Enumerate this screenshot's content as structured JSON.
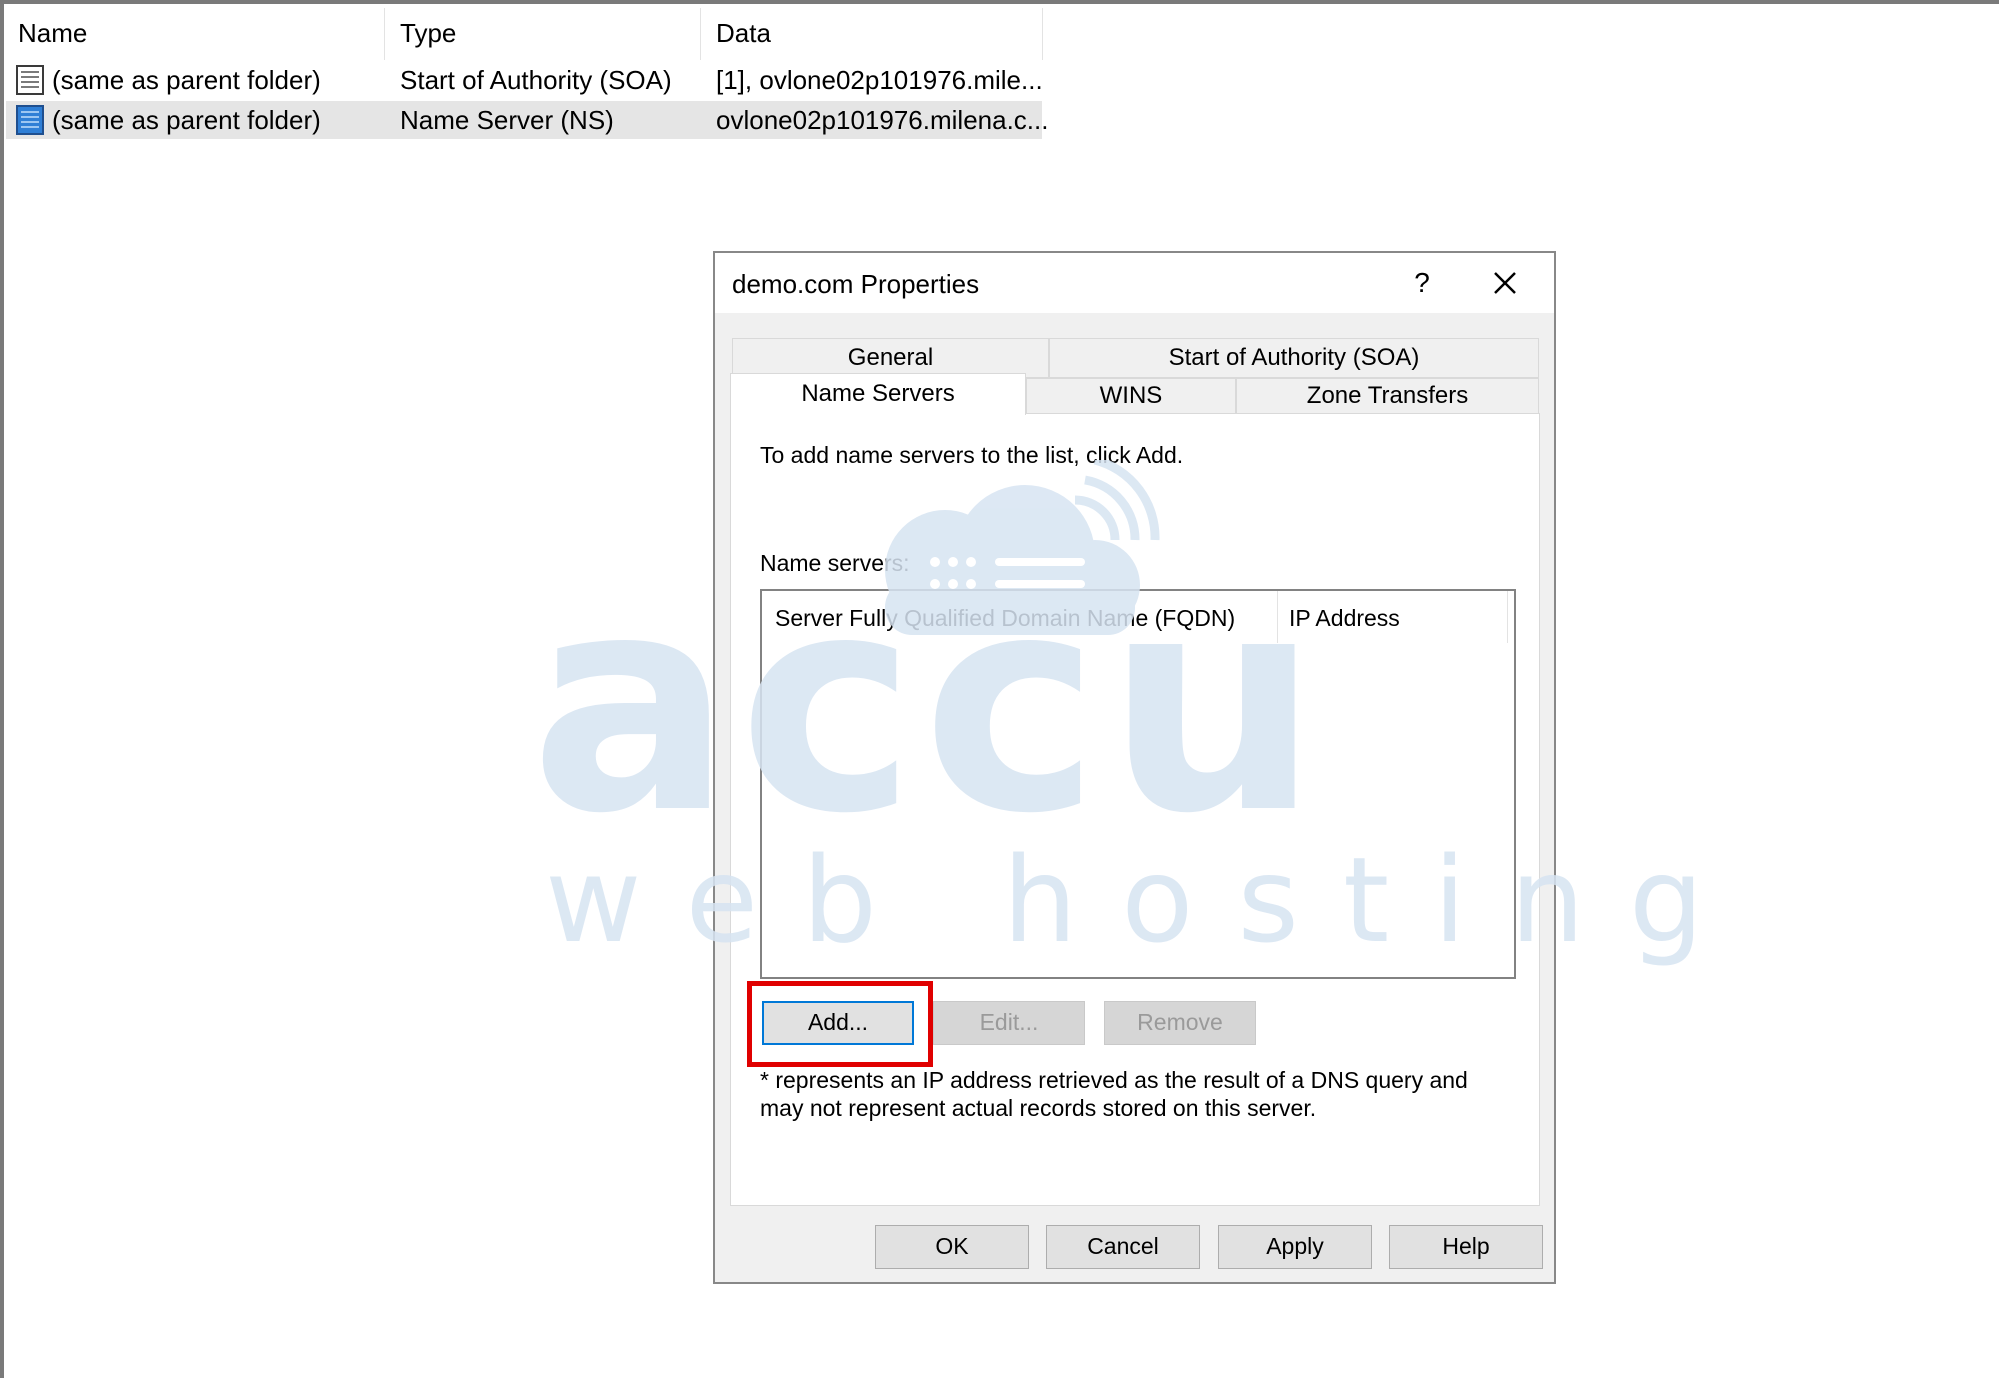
{
  "list": {
    "columns": [
      "Name",
      "Type",
      "Data"
    ],
    "rows": [
      {
        "name": "(same as parent folder)",
        "type": "Start of Authority (SOA)",
        "data": "[1], ovlone02p101976.mile...",
        "icon": "record-icon"
      },
      {
        "name": "(same as parent folder)",
        "type": "Name Server (NS)",
        "data": "ovlone02p101976.milena.c...",
        "icon": "record-icon-selected",
        "selected": true
      }
    ]
  },
  "dialog": {
    "title": "demo.com Properties",
    "help_label": "?",
    "tabs_row1": [
      "General",
      "Start of Authority (SOA)"
    ],
    "tabs_row2": [
      "Name Servers",
      "WINS",
      "Zone Transfers"
    ],
    "active_tab": "Name Servers",
    "instruction": "To add name servers to the list, click Add.",
    "list_label": "Name servers:",
    "list_columns": [
      "Server Fully Qualified Domain Name (FQDN)",
      "IP Address"
    ],
    "buttons": {
      "add": "Add...",
      "edit": "Edit...",
      "remove": "Remove"
    },
    "note_line1": "* represents an IP address retrieved as the result of a DNS query and",
    "note_line2": "may not represent actual records stored on this server.",
    "footer_buttons": {
      "ok": "OK",
      "cancel": "Cancel",
      "apply": "Apply",
      "help": "Help"
    }
  },
  "watermark": {
    "word": "accu",
    "tagline": "web hosting"
  },
  "colors": {
    "highlight": "#e00000",
    "focus_border": "#0078d7",
    "watermark": "#d7e4f2"
  }
}
